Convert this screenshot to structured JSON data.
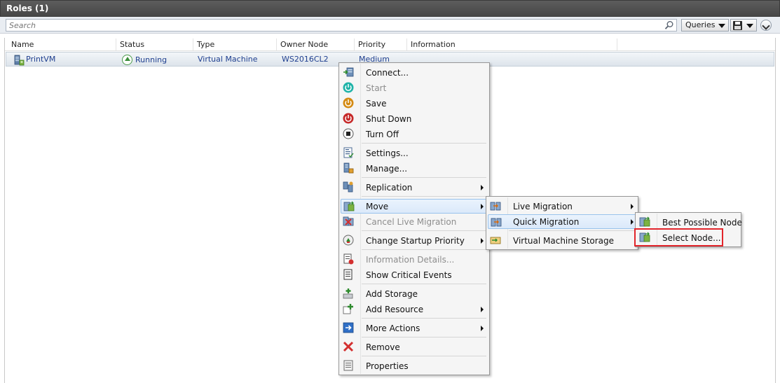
{
  "panel": {
    "title": "Roles (1)"
  },
  "search": {
    "placeholder": "Search"
  },
  "toolbar": {
    "queries_label": "Queries"
  },
  "columns": [
    "Name",
    "Status",
    "Type",
    "Owner Node",
    "Priority",
    "Information"
  ],
  "row": {
    "name": "PrintVM",
    "status": "Running",
    "type": "Virtual Machine",
    "owner_node": "WS2016CL2",
    "priority": "Medium"
  },
  "context_menu": {
    "items": [
      {
        "label": "Connect...",
        "icon": "connect-icon",
        "enabled": true
      },
      {
        "label": "Start",
        "icon": "start-icon",
        "enabled": false
      },
      {
        "label": "Save",
        "icon": "save-icon",
        "enabled": true
      },
      {
        "label": "Shut Down",
        "icon": "shutdown-icon",
        "enabled": true
      },
      {
        "label": "Turn Off",
        "icon": "turnoff-icon",
        "enabled": true
      },
      {
        "label": "Settings...",
        "icon": "settings-icon",
        "enabled": true
      },
      {
        "label": "Manage...",
        "icon": "manage-icon",
        "enabled": true
      },
      {
        "label": "Replication",
        "icon": "replication-icon",
        "enabled": true,
        "submenu": true
      },
      {
        "label": "Move",
        "icon": "move-icon",
        "enabled": true,
        "submenu": true,
        "highlighted": true
      },
      {
        "label": "Cancel Live Migration",
        "icon": "cancel-migration-icon",
        "enabled": false
      },
      {
        "label": "Change Startup Priority",
        "icon": "startup-priority-icon",
        "enabled": true,
        "submenu": true
      },
      {
        "label": "Information Details...",
        "icon": "information-details-icon",
        "enabled": false
      },
      {
        "label": "Show Critical Events",
        "icon": "critical-events-icon",
        "enabled": true
      },
      {
        "label": "Add Storage",
        "icon": "add-storage-icon",
        "enabled": true
      },
      {
        "label": "Add Resource",
        "icon": "add-resource-icon",
        "enabled": true,
        "submenu": true
      },
      {
        "label": "More Actions",
        "icon": "more-actions-icon",
        "enabled": true,
        "submenu": true
      },
      {
        "label": "Remove",
        "icon": "remove-icon",
        "enabled": true
      },
      {
        "label": "Properties",
        "icon": "properties-icon",
        "enabled": true
      }
    ]
  },
  "move_submenu": {
    "items": [
      {
        "label": "Live Migration",
        "icon": "live-migration-icon",
        "submenu": true
      },
      {
        "label": "Quick Migration",
        "icon": "quick-migration-icon",
        "submenu": true,
        "highlighted": true
      },
      {
        "label": "Virtual Machine Storage",
        "icon": "vm-storage-icon"
      }
    ]
  },
  "quick_migration_submenu": {
    "items": [
      {
        "label": "Best Possible Node",
        "icon": "best-node-icon"
      },
      {
        "label": "Select Node...",
        "icon": "select-node-icon",
        "emphasized": true
      }
    ]
  },
  "colors": {
    "title_bar": "#474747",
    "link_text": "#1f3f8f",
    "highlight_border": "#99c3ec",
    "emphasis_box": "#e2252b"
  }
}
